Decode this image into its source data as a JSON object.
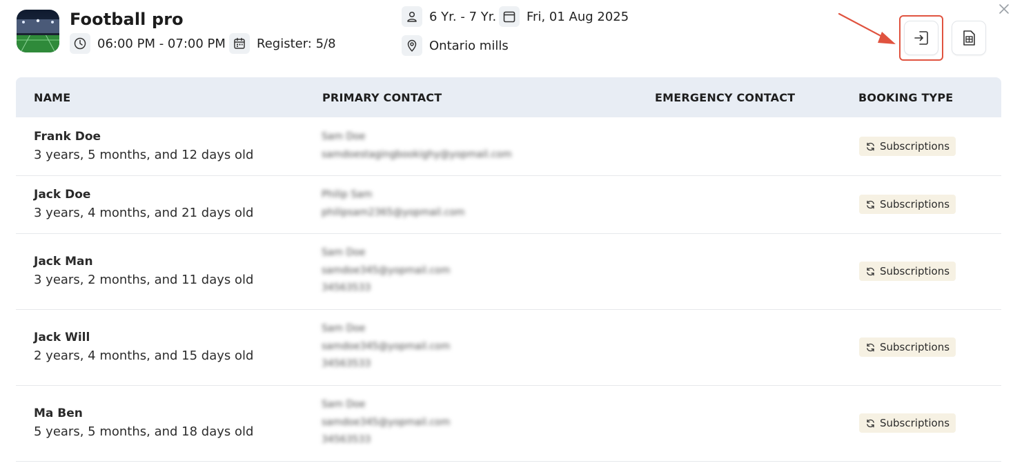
{
  "event": {
    "title": "Football pro",
    "time": "06:00 PM - 07:00 PM",
    "register": "Register: 5/8",
    "age_range": "6 Yr. - 7 Yr.",
    "date": "Fri, 01 Aug 2025",
    "location": "Ontario mills"
  },
  "icons": {
    "thumbnail": "stadium-image",
    "time": "clock-icon",
    "register": "calendar-grid-icon",
    "age": "user-icon",
    "date": "calendar-icon",
    "location": "map-pin-icon",
    "check_in": "sign-in-icon",
    "export": "spreadsheet-icon",
    "close": "close-icon",
    "booking": "refresh-icon"
  },
  "colors": {
    "highlight": "#e0533f",
    "header_bg": "#e8edf4",
    "badge_bg": "#f6f1e3"
  },
  "table": {
    "headers": [
      "NAME",
      "PRIMARY CONTACT",
      "EMERGENCY CONTACT",
      "BOOKING TYPE"
    ],
    "rows": [
      {
        "name": "Frank Doe",
        "age": "3 years, 5 months, and 12 days old",
        "contact": [
          "Sam Doe",
          "samdoestagingbookighy@yopmail.com"
        ],
        "emergency": "",
        "booking": "Subscriptions"
      },
      {
        "name": "Jack Doe",
        "age": "3 years, 4 months, and 21 days old",
        "contact": [
          "Philip Sam",
          "philipsam2365@yopmail.com"
        ],
        "emergency": "",
        "booking": "Subscriptions"
      },
      {
        "name": "Jack Man",
        "age": "3 years, 2 months, and 11 days old",
        "contact": [
          "Sam Doe",
          "samdoe345@yopmail.com",
          "34563533"
        ],
        "emergency": "",
        "booking": "Subscriptions"
      },
      {
        "name": "Jack Will",
        "age": "2 years, 4 months, and 15 days old",
        "contact": [
          "Sam Doe",
          "samdoe345@yopmail.com",
          "34563533"
        ],
        "emergency": "",
        "booking": "Subscriptions"
      },
      {
        "name": "Ma Ben",
        "age": "5 years, 5 months, and 18 days old",
        "contact": [
          "Sam Doe",
          "samdoe345@yopmail.com",
          "34563533"
        ],
        "emergency": "",
        "booking": "Subscriptions"
      }
    ]
  }
}
